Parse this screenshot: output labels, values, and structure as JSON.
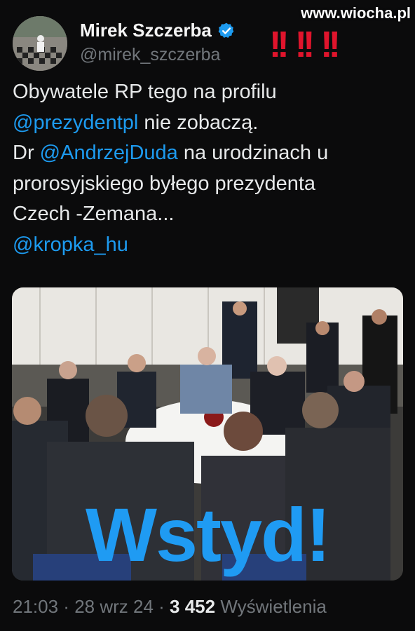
{
  "watermark": "www.wiocha.pl",
  "exclamations": [
    "!!",
    "!!",
    "!!"
  ],
  "author": {
    "name": "Mirek Szczerba",
    "handle": "@mirek_szczerba",
    "verified_icon": "verified-badge-icon"
  },
  "tweet": {
    "line1_text": "Obywatele RP tego na profilu",
    "mention_prezydent": "@prezydentpl",
    "line2_text": " nie zobaczą.",
    "line3_prefix": "Dr ",
    "mention_duda": "@AndrzejDuda",
    "line3_text": " na urodzinach u",
    "line4_text": "prorosyjskiego byłego prezydenta",
    "line5_text": "Czech -Zemana...",
    "mention_kropka": "@kropka_hu"
  },
  "image": {
    "overlay_text": "Wstyd!"
  },
  "meta": {
    "time": "21:03",
    "sep1": " · ",
    "date": "28 wrz 24",
    "sep2": " · ",
    "views_count": "3 452",
    "views_label": " Wyświetlenia"
  },
  "colors": {
    "background": "#0b0b0c",
    "accent": "#1d9bf0",
    "muted": "#71767b",
    "exclamation": "#e0142c"
  }
}
